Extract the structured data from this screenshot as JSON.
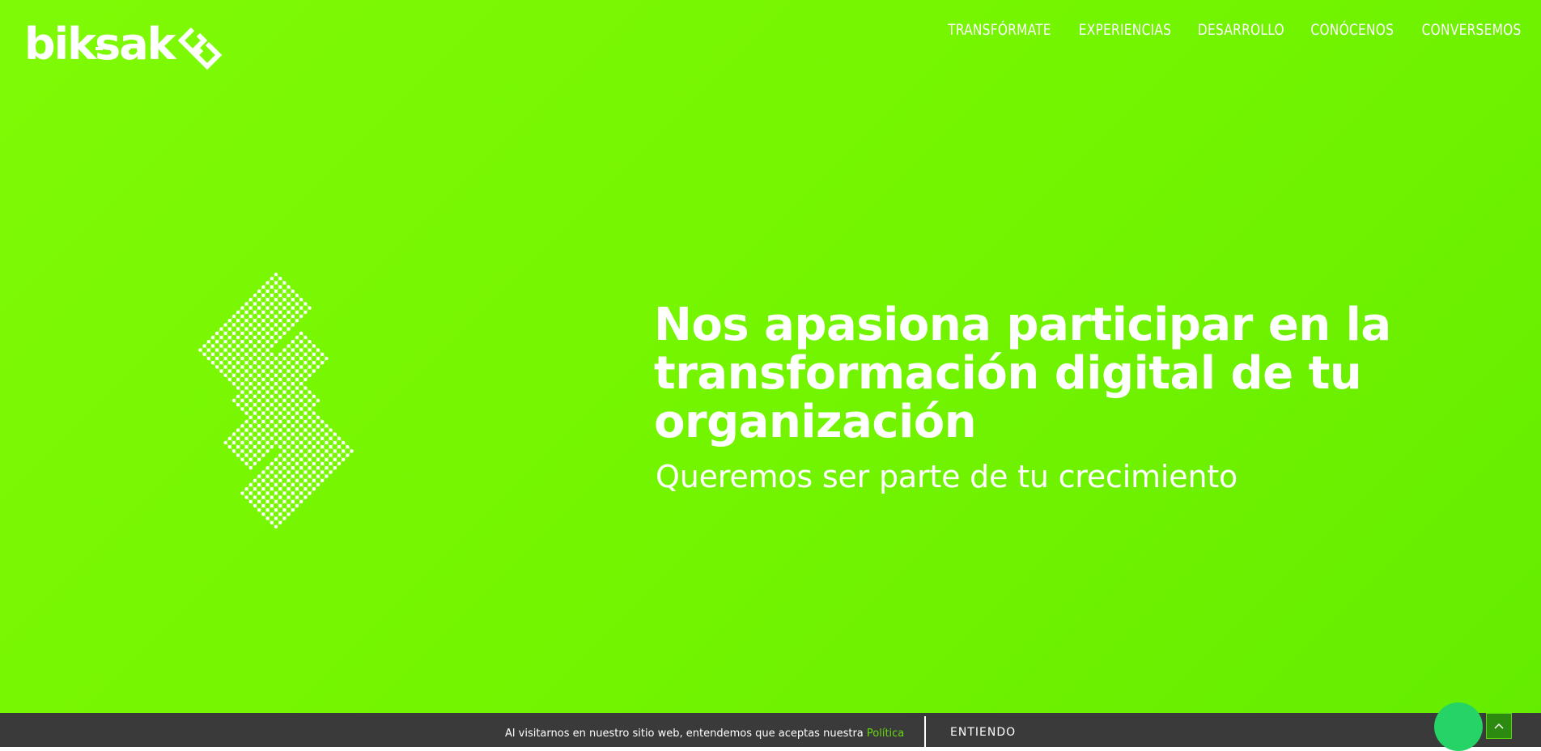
{
  "brand": {
    "logo_text": "biksak",
    "accent_color": "#74f500",
    "link_color": "#67d811"
  },
  "nav": {
    "items": [
      "TRANSFÓRMATE",
      "EXPERIENCIAS",
      "DESARROLLO",
      "CONÓCENOS",
      "CONVERSEMOS"
    ]
  },
  "hero": {
    "title": "Nos apasiona participar en la transformación digital de tu organización",
    "subtitle": "Queremos ser parte de tu crecimiento",
    "graphic_icon": "dotted-diamond-icon"
  },
  "cookie": {
    "text": "Al visitarnos en nuestro sitio web, entendemos que aceptas nuestra",
    "link_label": "Política",
    "accept_label": "ENTIENDO",
    "background": "#3a3a3a"
  },
  "widgets": {
    "chat_icon": "whatsapp-chat-icon",
    "scroll_icon": "chevron-up-icon"
  }
}
